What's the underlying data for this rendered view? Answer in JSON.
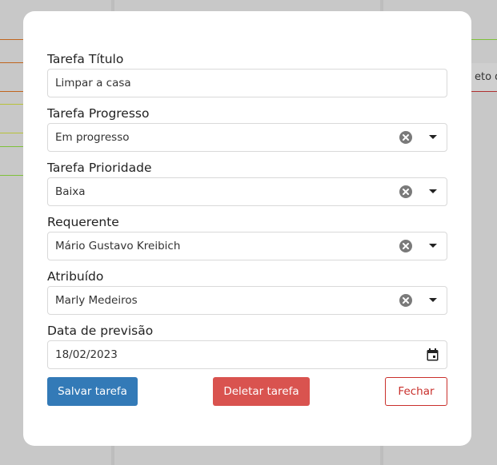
{
  "background": {
    "snippet_text": "eto de"
  },
  "form": {
    "title_label": "Tarefa Título",
    "title_value": "Limpar a casa",
    "progress_label": "Tarefa Progresso",
    "progress_value": "Em progresso",
    "priority_label": "Tarefa Prioridade",
    "priority_value": "Baixa",
    "requester_label": "Requerente",
    "requester_value": "Mário Gustavo Kreibich",
    "assignee_label": "Atribuído",
    "assignee_value": "Marly Medeiros",
    "due_date_label": "Data de previsão",
    "due_date_value": "18/02/2023"
  },
  "actions": {
    "save_label": "Salvar tarefa",
    "delete_label": "Deletar tarefa",
    "close_label": "Fechar"
  },
  "colors": {
    "save": "#337ab7",
    "delete": "#d9534f",
    "close": "#c9302c"
  }
}
